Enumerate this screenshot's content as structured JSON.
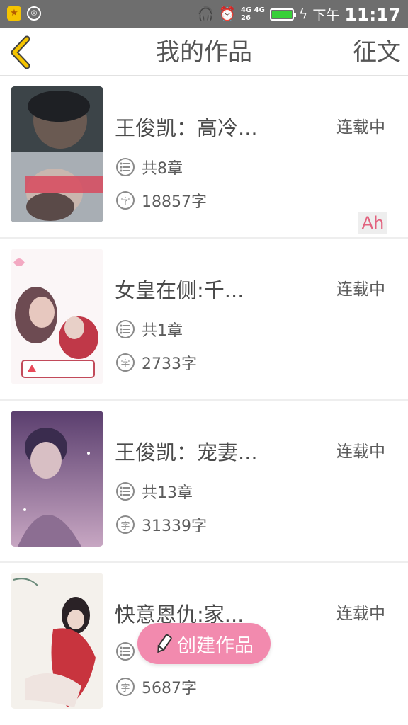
{
  "status_bar": {
    "network_top": "4G 4G",
    "network_bottom": "26",
    "ampm": "下午",
    "time": "11:17"
  },
  "nav": {
    "title": "我的作品",
    "action_label": "征文",
    "back_icon": "chevron-left-icon",
    "accent_color": "#f5c400"
  },
  "works": [
    {
      "title": "王俊凯：高冷...",
      "status": "连载中",
      "chapters": "共8章",
      "words": "18857字"
    },
    {
      "title": "女皇在侧:千...",
      "status": "连载中",
      "chapters": "共1章",
      "words": "2733字"
    },
    {
      "title": "王俊凯：宠妻...",
      "status": "连载中",
      "chapters": "共13章",
      "words": "31339字"
    },
    {
      "title": "快意恩仇:家...",
      "status": "连载中",
      "chapters": "",
      "words": "5687字"
    }
  ],
  "overlay_badge": "Ah",
  "fab": {
    "label": "创建作品",
    "icon": "pencil-icon",
    "color": "#f28aae"
  },
  "icons": {
    "chapters": "list-icon",
    "words": "character-count-icon"
  },
  "meta_icon_char": "字"
}
